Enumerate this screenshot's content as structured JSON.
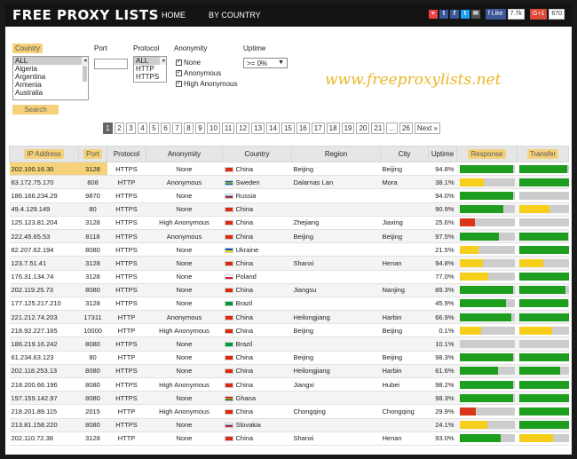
{
  "site": {
    "logo": "FREE PROXY LISTS",
    "watermark": "www.freeproxylists.net"
  },
  "nav": [
    "HOME",
    "BY COUNTRY"
  ],
  "social": {
    "like_label": "Like",
    "like_count": "7.7k",
    "gplus_label": "G+1",
    "gplus_count": "670"
  },
  "filters": {
    "country_label": "Country",
    "country_options": [
      "ALL",
      "Algeria",
      "Argentina",
      "Armenia",
      "Australia"
    ],
    "port_label": "Port",
    "protocol_label": "Protocol",
    "protocol_options": [
      "ALL",
      "HTTP",
      "HTTPS"
    ],
    "anonymity_label": "Anonymity",
    "anonymity_options": [
      "None",
      "Anonymous",
      "High Anonymous"
    ],
    "uptime_label": "Uptime",
    "uptime_value": ">= 0%",
    "search_label": "Search"
  },
  "pagination": {
    "pages": [
      "1",
      "2",
      "3",
      "4",
      "5",
      "6",
      "7",
      "8",
      "9",
      "10",
      "11",
      "12",
      "13",
      "14",
      "15",
      "16",
      "17",
      "18",
      "19",
      "20",
      "21",
      "...",
      "26",
      "Next »"
    ],
    "current": "1"
  },
  "table": {
    "headers": [
      "IP Address",
      "Port",
      "Protocol",
      "Anonymity",
      "Country",
      "Region",
      "City",
      "Uptime",
      "Response",
      "Transfer"
    ],
    "rows": [
      {
        "ip": "202.100.16.30",
        "port": "3128",
        "protocol": "HTTPS",
        "anonymity": "None",
        "country": "China",
        "region": "Beijing",
        "city": "Beijing",
        "uptime": "94.8%",
        "response": 0.97,
        "response_color": "green",
        "transfer": 0.88,
        "transfer_color": "green",
        "flag": "cn"
      },
      {
        "ip": "83.172.75.170",
        "port": "808",
        "protocol": "HTTP",
        "anonymity": "Anonymous",
        "country": "Sweden",
        "region": "Dalarnas Lan",
        "city": "Mora",
        "uptime": "38.1%",
        "response": 0.45,
        "response_color": "yellow",
        "transfer": 0.95,
        "transfer_color": "green",
        "flag": "se"
      },
      {
        "ip": "186.166.234.29",
        "port": "9870",
        "protocol": "HTTPS",
        "anonymity": "None",
        "country": "Russia",
        "region": "",
        "city": "",
        "uptime": "94.0%",
        "response": 0.97,
        "response_color": "green",
        "transfer": 0.0,
        "transfer_color": "green",
        "flag": "ru"
      },
      {
        "ip": "49.4.129.149",
        "port": "80",
        "protocol": "HTTPS",
        "anonymity": "None",
        "country": "China",
        "region": "",
        "city": "",
        "uptime": "90.9%",
        "response": 0.8,
        "response_color": "green",
        "transfer": 0.55,
        "transfer_color": "yellow",
        "flag": "cn"
      },
      {
        "ip": "125.123.81.204",
        "port": "3128",
        "protocol": "HTTPS",
        "anonymity": "High Anonymous",
        "country": "China",
        "region": "Zhejiang",
        "city": "Jiaxing",
        "uptime": "25.6%",
        "response": 0.28,
        "response_color": "red",
        "transfer": 0.0,
        "transfer_color": "green",
        "flag": "cn"
      },
      {
        "ip": "222.45.65.53",
        "port": "8118",
        "protocol": "HTTPS",
        "anonymity": "Anonymous",
        "country": "China",
        "region": "Beijing",
        "city": "Beijing",
        "uptime": "97.5%",
        "response": 0.72,
        "response_color": "green",
        "transfer": 0.9,
        "transfer_color": "green",
        "flag": "cn"
      },
      {
        "ip": "82.207.62.194",
        "port": "8080",
        "protocol": "HTTPS",
        "anonymity": "None",
        "country": "Ukraine",
        "region": "",
        "city": "",
        "uptime": "21.5%",
        "response": 0.35,
        "response_color": "yellow",
        "transfer": 0.92,
        "transfer_color": "green",
        "flag": "ua"
      },
      {
        "ip": "123.7.51.41",
        "port": "3128",
        "protocol": "HTTPS",
        "anonymity": "None",
        "country": "China",
        "region": "Shanxi",
        "city": "Henan",
        "uptime": "94.8%",
        "response": 0.42,
        "response_color": "yellow",
        "transfer": 0.45,
        "transfer_color": "yellow",
        "flag": "cn"
      },
      {
        "ip": "176.31.134.74",
        "port": "3128",
        "protocol": "HTTPS",
        "anonymity": "None",
        "country": "Poland",
        "region": "",
        "city": "",
        "uptime": "77.0%",
        "response": 0.52,
        "response_color": "yellow",
        "transfer": 1.0,
        "transfer_color": "green",
        "flag": "pl"
      },
      {
        "ip": "202.119.25.73",
        "port": "8080",
        "protocol": "HTTPS",
        "anonymity": "None",
        "country": "China",
        "region": "Jiangsu",
        "city": "Nanjing",
        "uptime": "89.3%",
        "response": 0.97,
        "response_color": "green",
        "transfer": 0.85,
        "transfer_color": "green",
        "flag": "cn"
      },
      {
        "ip": "177.125.217.210",
        "port": "3128",
        "protocol": "HTTPS",
        "anonymity": "None",
        "country": "Brazil",
        "region": "",
        "city": "",
        "uptime": "45.9%",
        "response": 0.85,
        "response_color": "green",
        "transfer": 0.9,
        "transfer_color": "green",
        "flag": "br"
      },
      {
        "ip": "221.212.74.203",
        "port": "17311",
        "protocol": "HTTP",
        "anonymity": "Anonymous",
        "country": "China",
        "region": "Heilongjiang",
        "city": "Harbin",
        "uptime": "66.9%",
        "response": 0.95,
        "response_color": "green",
        "transfer": 0.97,
        "transfer_color": "green",
        "flag": "cn"
      },
      {
        "ip": "218.92.227.165",
        "port": "10000",
        "protocol": "HTTP",
        "anonymity": "High Anonymous",
        "country": "China",
        "region": "Beijing",
        "city": "Beijing",
        "uptime": "0.1%",
        "response": 0.4,
        "response_color": "yellow",
        "transfer": 0.6,
        "transfer_color": "yellow",
        "flag": "cn"
      },
      {
        "ip": "186.219.16.242",
        "port": "8080",
        "protocol": "HTTPS",
        "anonymity": "None",
        "country": "Brazil",
        "region": "",
        "city": "",
        "uptime": "10.1%",
        "response": 0.0,
        "response_color": "green",
        "transfer": 0.0,
        "transfer_color": "green",
        "flag": "br"
      },
      {
        "ip": "61.234.63.123",
        "port": "80",
        "protocol": "HTTP",
        "anonymity": "None",
        "country": "China",
        "region": "Beijing",
        "city": "Beijing",
        "uptime": "98.3%",
        "response": 0.97,
        "response_color": "green",
        "transfer": 0.92,
        "transfer_color": "green",
        "flag": "cn"
      },
      {
        "ip": "202.118.253.13",
        "port": "8080",
        "protocol": "HTTPS",
        "anonymity": "None",
        "country": "China",
        "region": "Heilongjiang",
        "city": "Harbin",
        "uptime": "61.6%",
        "response": 0.7,
        "response_color": "green",
        "transfer": 0.75,
        "transfer_color": "green",
        "flag": "cn"
      },
      {
        "ip": "218.200.66.196",
        "port": "8080",
        "protocol": "HTTPS",
        "anonymity": "High Anonymous",
        "country": "China",
        "region": "Jiangxi",
        "city": "Hubei",
        "uptime": "98.2%",
        "response": 0.97,
        "response_color": "green",
        "transfer": 0.93,
        "transfer_color": "green",
        "flag": "cn"
      },
      {
        "ip": "197.159.142.97",
        "port": "8080",
        "protocol": "HTTPS",
        "anonymity": "None",
        "country": "Ghana",
        "region": "",
        "city": "",
        "uptime": "98.3%",
        "response": 0.97,
        "response_color": "green",
        "transfer": 0.97,
        "transfer_color": "green",
        "flag": "gh"
      },
      {
        "ip": "218.201.89.115",
        "port": "2015",
        "protocol": "HTTP",
        "anonymity": "High Anonymous",
        "country": "China",
        "region": "Chongqing",
        "city": "Chongqing",
        "uptime": "29.9%",
        "response": 0.3,
        "response_color": "red",
        "transfer": 0.95,
        "transfer_color": "green",
        "flag": "cn"
      },
      {
        "ip": "213.81.158.220",
        "port": "8080",
        "protocol": "HTTPS",
        "anonymity": "None",
        "country": "Slovakia",
        "region": "",
        "city": "",
        "uptime": "24.1%",
        "response": 0.5,
        "response_color": "yellow",
        "transfer": 0.93,
        "transfer_color": "green",
        "flag": "sk"
      },
      {
        "ip": "202.110.72.38",
        "port": "3128",
        "protocol": "HTTP",
        "anonymity": "None",
        "country": "China",
        "region": "Shanxi",
        "city": "Henan",
        "uptime": "93.0%",
        "response": 0.75,
        "response_color": "green",
        "transfer": 0.62,
        "transfer_color": "yellow",
        "flag": "cn"
      }
    ]
  },
  "colors": {
    "green": "#1e9e1e",
    "yellow": "#f7cf1a",
    "red": "#d9361a",
    "accent": "#f5d27a"
  }
}
